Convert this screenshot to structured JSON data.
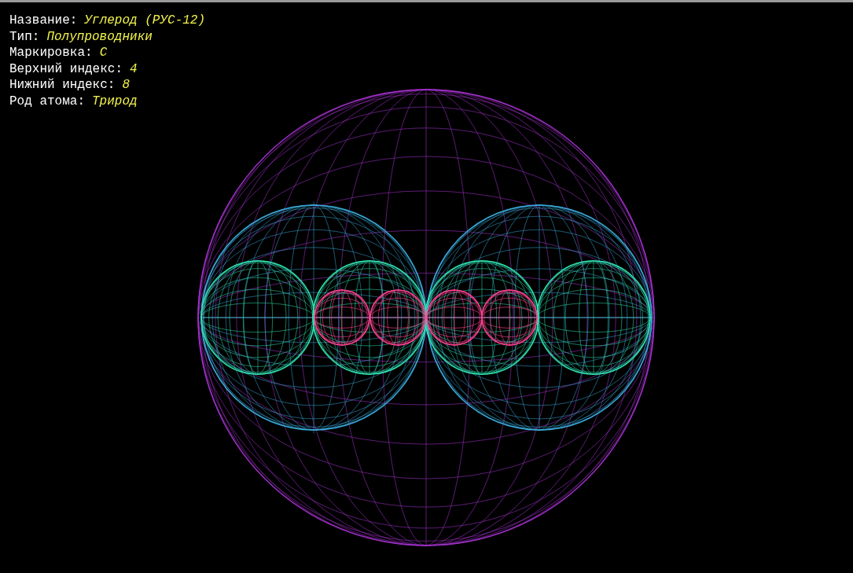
{
  "info": [
    {
      "label": "Название:",
      "value": "Углерод (РУС-12)"
    },
    {
      "label": "Тип:",
      "value": "Полупроводники"
    },
    {
      "label": "Маркировка:",
      "value": "C"
    },
    {
      "label": "Верхний индекс:",
      "value": "4"
    },
    {
      "label": "Нижний индекс:",
      "value": "8"
    },
    {
      "label": "Род атома:",
      "value": "Трирод"
    }
  ]
}
